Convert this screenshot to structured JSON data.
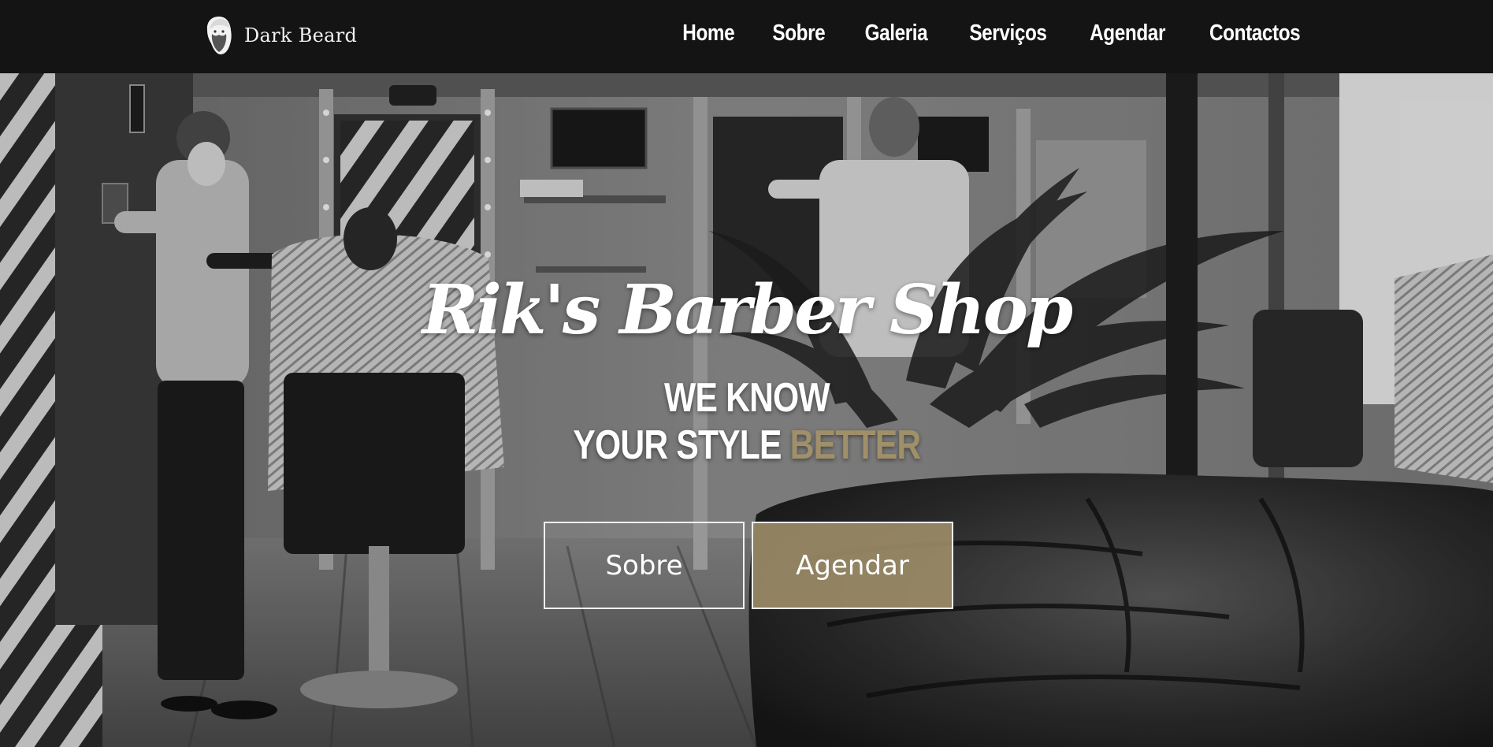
{
  "nav": {
    "brand": "Dark Beard",
    "links": [
      {
        "label": "Home"
      },
      {
        "label": "Sobre"
      },
      {
        "label": "Galeria"
      },
      {
        "label": "Serviços"
      },
      {
        "label": "Agendar"
      },
      {
        "label": "Contactos"
      }
    ]
  },
  "hero": {
    "title": "Rik's Barber Shop",
    "line1": "WE KNOW",
    "line2_prefix": "YOUR STYLE ",
    "line2_accent": "BETTER",
    "buttons": {
      "sobre": "Sobre",
      "agendar": "Agendar"
    }
  },
  "colors": {
    "navbar": "#141414",
    "accent": "#a0906a",
    "text": "#ffffff"
  }
}
